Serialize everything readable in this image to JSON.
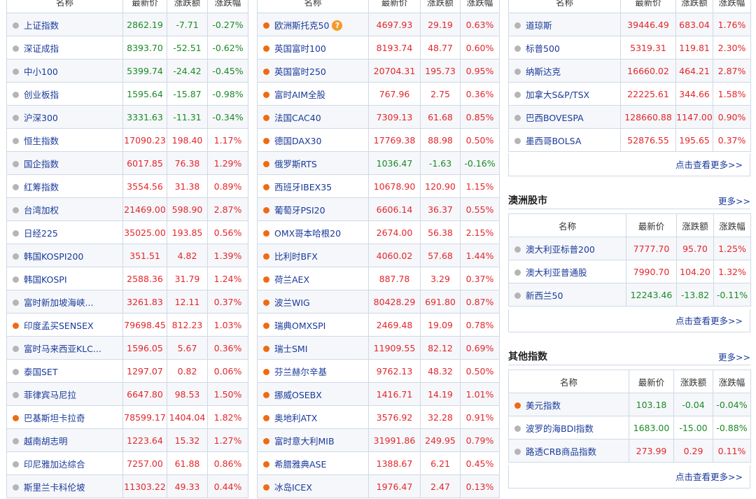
{
  "headers": {
    "name": "名称",
    "latest": "最新价",
    "change": "涨跌额",
    "pct": "涨跌幅"
  },
  "asia": [
    {
      "name": "上证指数",
      "price": "2862.19",
      "chg": "-7.71",
      "pct": "-0.27%",
      "dir": "down",
      "open": false
    },
    {
      "name": "深证成指",
      "price": "8393.70",
      "chg": "-52.51",
      "pct": "-0.62%",
      "dir": "down",
      "open": false
    },
    {
      "name": "中小100",
      "price": "5399.74",
      "chg": "-24.42",
      "pct": "-0.45%",
      "dir": "down",
      "open": false
    },
    {
      "name": "创业板指",
      "price": "1595.64",
      "chg": "-15.87",
      "pct": "-0.98%",
      "dir": "down",
      "open": false
    },
    {
      "name": "沪深300",
      "price": "3331.63",
      "chg": "-11.31",
      "pct": "-0.34%",
      "dir": "down",
      "open": false
    },
    {
      "name": "恒生指数",
      "price": "17090.23",
      "chg": "198.40",
      "pct": "1.17%",
      "dir": "up",
      "open": false
    },
    {
      "name": "国企指数",
      "price": "6017.85",
      "chg": "76.38",
      "pct": "1.29%",
      "dir": "up",
      "open": false
    },
    {
      "name": "红筹指数",
      "price": "3554.56",
      "chg": "31.38",
      "pct": "0.89%",
      "dir": "up",
      "open": false
    },
    {
      "name": "台湾加权",
      "price": "21469.00",
      "chg": "598.90",
      "pct": "2.87%",
      "dir": "up",
      "open": false
    },
    {
      "name": "日经225",
      "price": "35025.00",
      "chg": "193.85",
      "pct": "0.56%",
      "dir": "up",
      "open": false
    },
    {
      "name": "韩国KOSPI200",
      "price": "351.51",
      "chg": "4.82",
      "pct": "1.39%",
      "dir": "up",
      "open": false
    },
    {
      "name": "韩国KOSPI",
      "price": "2588.36",
      "chg": "31.79",
      "pct": "1.24%",
      "dir": "up",
      "open": false
    },
    {
      "name": "富时新加坡海峡...",
      "price": "3261.83",
      "chg": "12.11",
      "pct": "0.37%",
      "dir": "up",
      "open": false
    },
    {
      "name": "印度孟买SENSEX",
      "price": "79698.45",
      "chg": "812.23",
      "pct": "1.03%",
      "dir": "up",
      "open": true
    },
    {
      "name": "富时马来西亚KLC...",
      "price": "1596.05",
      "chg": "5.67",
      "pct": "0.36%",
      "dir": "up",
      "open": false
    },
    {
      "name": "泰国SET",
      "price": "1297.07",
      "chg": "0.82",
      "pct": "0.06%",
      "dir": "up",
      "open": false
    },
    {
      "name": "菲律宾马尼拉",
      "price": "6647.80",
      "chg": "98.53",
      "pct": "1.50%",
      "dir": "up",
      "open": false
    },
    {
      "name": "巴基斯坦卡拉奇",
      "price": "78599.17",
      "chg": "1404.04",
      "pct": "1.82%",
      "dir": "up",
      "open": true
    },
    {
      "name": "越南胡志明",
      "price": "1223.64",
      "chg": "15.32",
      "pct": "1.27%",
      "dir": "up",
      "open": false
    },
    {
      "name": "印尼雅加达综合",
      "price": "7257.00",
      "chg": "61.88",
      "pct": "0.86%",
      "dir": "up",
      "open": false
    },
    {
      "name": "斯里兰卡科伦坡",
      "price": "11303.22",
      "chg": "49.33",
      "pct": "0.44%",
      "dir": "up",
      "open": false
    }
  ],
  "europe": [
    {
      "name": "欧洲斯托克50",
      "price": "4697.93",
      "chg": "29.19",
      "pct": "0.63%",
      "dir": "up",
      "open": true,
      "help": "?"
    },
    {
      "name": "英国富时100",
      "price": "8193.74",
      "chg": "48.77",
      "pct": "0.60%",
      "dir": "up",
      "open": true
    },
    {
      "name": "英国富时250",
      "price": "20704.31",
      "chg": "195.73",
      "pct": "0.95%",
      "dir": "up",
      "open": true
    },
    {
      "name": "富时AIM全股",
      "price": "767.96",
      "chg": "2.75",
      "pct": "0.36%",
      "dir": "up",
      "open": true
    },
    {
      "name": "法国CAC40",
      "price": "7309.13",
      "chg": "61.68",
      "pct": "0.85%",
      "dir": "up",
      "open": true
    },
    {
      "name": "德国DAX30",
      "price": "17769.38",
      "chg": "88.98",
      "pct": "0.50%",
      "dir": "up",
      "open": true
    },
    {
      "name": "俄罗斯RTS",
      "price": "1036.47",
      "chg": "-1.63",
      "pct": "-0.16%",
      "dir": "down",
      "open": true
    },
    {
      "name": "西班牙IBEX35",
      "price": "10678.90",
      "chg": "120.90",
      "pct": "1.15%",
      "dir": "up",
      "open": true
    },
    {
      "name": "葡萄牙PSI20",
      "price": "6606.14",
      "chg": "36.37",
      "pct": "0.55%",
      "dir": "up",
      "open": true
    },
    {
      "name": "OMX哥本哈根20",
      "price": "2674.00",
      "chg": "56.38",
      "pct": "2.15%",
      "dir": "up",
      "open": true
    },
    {
      "name": "比利时BFX",
      "price": "4060.02",
      "chg": "57.68",
      "pct": "1.44%",
      "dir": "up",
      "open": true
    },
    {
      "name": "荷兰AEX",
      "price": "887.78",
      "chg": "3.29",
      "pct": "0.37%",
      "dir": "up",
      "open": true
    },
    {
      "name": "波兰WIG",
      "price": "80428.29",
      "chg": "691.80",
      "pct": "0.87%",
      "dir": "up",
      "open": true
    },
    {
      "name": "瑞典OMXSPI",
      "price": "2469.48",
      "chg": "19.09",
      "pct": "0.78%",
      "dir": "up",
      "open": true
    },
    {
      "name": "瑞士SMI",
      "price": "11909.55",
      "chg": "82.12",
      "pct": "0.69%",
      "dir": "up",
      "open": true
    },
    {
      "name": "芬兰赫尔辛基",
      "price": "9762.13",
      "chg": "48.32",
      "pct": "0.50%",
      "dir": "up",
      "open": true
    },
    {
      "name": "挪威OSEBX",
      "price": "1416.71",
      "chg": "14.19",
      "pct": "1.01%",
      "dir": "up",
      "open": true
    },
    {
      "name": "奥地利ATX",
      "price": "3576.92",
      "chg": "32.28",
      "pct": "0.91%",
      "dir": "up",
      "open": true
    },
    {
      "name": "富时意大利MIB",
      "price": "31991.86",
      "chg": "249.95",
      "pct": "0.79%",
      "dir": "up",
      "open": true
    },
    {
      "name": "希腊雅典ASE",
      "price": "1388.67",
      "chg": "6.21",
      "pct": "0.45%",
      "dir": "up",
      "open": true
    },
    {
      "name": "冰岛ICEX",
      "price": "1976.47",
      "chg": "2.47",
      "pct": "0.13%",
      "dir": "up",
      "open": true
    }
  ],
  "america": [
    {
      "name": "道琼斯",
      "price": "39446.49",
      "chg": "683.04",
      "pct": "1.76%",
      "dir": "up",
      "open": false
    },
    {
      "name": "标普500",
      "price": "5319.31",
      "chg": "119.81",
      "pct": "2.30%",
      "dir": "up",
      "open": false
    },
    {
      "name": "纳斯达克",
      "price": "16660.02",
      "chg": "464.21",
      "pct": "2.87%",
      "dir": "up",
      "open": false
    },
    {
      "name": "加拿大S&P/TSX",
      "price": "22225.61",
      "chg": "344.66",
      "pct": "1.58%",
      "dir": "up",
      "open": false
    },
    {
      "name": "巴西BOVESPA",
      "price": "128660.88",
      "chg": "1147.00",
      "pct": "0.90%",
      "dir": "up",
      "open": false
    },
    {
      "name": "墨西哥BOLSA",
      "price": "52876.55",
      "chg": "195.65",
      "pct": "0.37%",
      "dir": "up",
      "open": false
    }
  ],
  "australia": {
    "title": "澳洲股市",
    "more": "更多>>",
    "rows": [
      {
        "name": "澳大利亚标普200",
        "price": "7777.70",
        "chg": "95.70",
        "pct": "1.25%",
        "dir": "up",
        "open": false
      },
      {
        "name": "澳大利亚普通股",
        "price": "7990.70",
        "chg": "104.20",
        "pct": "1.32%",
        "dir": "up",
        "open": false
      },
      {
        "name": "新西兰50",
        "price": "12243.46",
        "chg": "-13.82",
        "pct": "-0.11%",
        "dir": "down",
        "open": false
      }
    ]
  },
  "other": {
    "title": "其他指数",
    "more": "更多>>",
    "rows": [
      {
        "name": "美元指数",
        "price": "103.18",
        "chg": "-0.04",
        "pct": "-0.04%",
        "dir": "down",
        "open": true
      },
      {
        "name": "波罗的海BDI指数",
        "price": "1683.00",
        "chg": "-15.00",
        "pct": "-0.88%",
        "dir": "down",
        "open": false
      },
      {
        "name": "路透CRB商品指数",
        "price": "273.99",
        "chg": "0.29",
        "pct": "0.11%",
        "dir": "up",
        "open": false
      }
    ]
  },
  "view_more": "点击查看更多>>",
  "colors": {
    "up": "#e4262b",
    "down": "#1a8a25",
    "open_dot": "#f06a12",
    "closed_dot": "#b5b5b5",
    "link": "#1a3a9a"
  }
}
